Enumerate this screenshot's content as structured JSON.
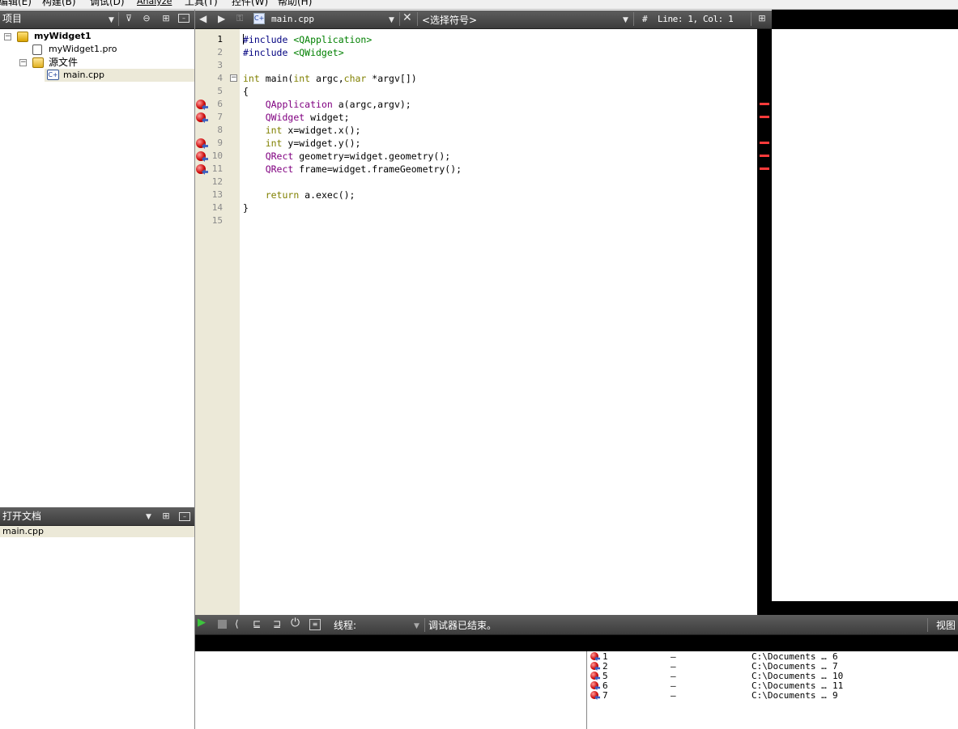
{
  "menubar": {
    "items": [
      "编辑(E)",
      "构建(B)",
      "调试(D)",
      "Analyze",
      "工具(T)",
      "控件(W)",
      "帮助(H)"
    ]
  },
  "projects": {
    "title": "项目",
    "project_name": "myWidget1",
    "pro_file": "myWidget1.pro",
    "sources_folder": "源文件",
    "source_file": "main.cpp"
  },
  "editor_toolbar": {
    "file_name": "main.cpp",
    "symbol_placeholder": "<选择符号>",
    "hash": "#",
    "position": "Line: 1, Col: 1"
  },
  "editor": {
    "line_numbers": [
      "1",
      "2",
      "3",
      "4",
      "5",
      "6",
      "7",
      "8",
      "9",
      "10",
      "11",
      "12",
      "13",
      "14",
      "15"
    ],
    "current_line": 1,
    "breakpoint_lines": [
      6,
      7,
      9,
      10,
      11
    ],
    "lines": [
      [
        {
          "t": "#include ",
          "c": "pp"
        },
        {
          "t": "<QApplication>",
          "c": "inc"
        }
      ],
      [
        {
          "t": "#include ",
          "c": "pp"
        },
        {
          "t": "<QWidget>",
          "c": "inc"
        }
      ],
      [],
      [
        {
          "t": "int",
          "c": "kw"
        },
        {
          "t": " main(",
          "c": ""
        },
        {
          "t": "int",
          "c": "kw"
        },
        {
          "t": " argc,",
          "c": ""
        },
        {
          "t": "char",
          "c": "kw"
        },
        {
          "t": " *argv[])",
          "c": ""
        }
      ],
      [
        {
          "t": "{",
          "c": ""
        }
      ],
      [
        {
          "t": "    ",
          "c": ""
        },
        {
          "t": "QApplication",
          "c": "ty"
        },
        {
          "t": " a(argc,argv);",
          "c": ""
        }
      ],
      [
        {
          "t": "    ",
          "c": ""
        },
        {
          "t": "QWidget",
          "c": "ty"
        },
        {
          "t": " widget;",
          "c": ""
        }
      ],
      [
        {
          "t": "    ",
          "c": ""
        },
        {
          "t": "int",
          "c": "kw"
        },
        {
          "t": " x=widget.x();",
          "c": ""
        }
      ],
      [
        {
          "t": "    ",
          "c": ""
        },
        {
          "t": "int",
          "c": "kw"
        },
        {
          "t": " y=widget.y();",
          "c": ""
        }
      ],
      [
        {
          "t": "    ",
          "c": ""
        },
        {
          "t": "QRect",
          "c": "ty"
        },
        {
          "t": " geometry=widget.geometry();",
          "c": ""
        }
      ],
      [
        {
          "t": "    ",
          "c": ""
        },
        {
          "t": "QRect",
          "c": "ty"
        },
        {
          "t": " frame=widget.frameGeometry();",
          "c": ""
        }
      ],
      [],
      [
        {
          "t": "    ",
          "c": ""
        },
        {
          "t": "return",
          "c": "kw"
        },
        {
          "t": " a.exec();",
          "c": ""
        }
      ],
      [
        {
          "t": "}",
          "c": ""
        }
      ],
      []
    ]
  },
  "open_docs": {
    "title": "打开文档",
    "items": [
      "main.cpp"
    ]
  },
  "debugger": {
    "thread_label": "线程:",
    "status": "调试器已结束。",
    "view_label": "视图",
    "breakpoints": [
      {
        "num": "1",
        "func": "–",
        "file": "C:\\Documents …",
        "line": "6"
      },
      {
        "num": "2",
        "func": "–",
        "file": "C:\\Documents …",
        "line": "7"
      },
      {
        "num": "5",
        "func": "–",
        "file": "C:\\Documents …",
        "line": "10"
      },
      {
        "num": "6",
        "func": "–",
        "file": "C:\\Documents …",
        "line": "11"
      },
      {
        "num": "7",
        "func": "–",
        "file": "C:\\Documents …",
        "line": "9"
      }
    ]
  },
  "colors": {
    "gutter": "#ece9d8",
    "header_bar": "#4a4a4a",
    "breakpoint": "#c80000",
    "scroll_mark": "#ff3a3a"
  }
}
